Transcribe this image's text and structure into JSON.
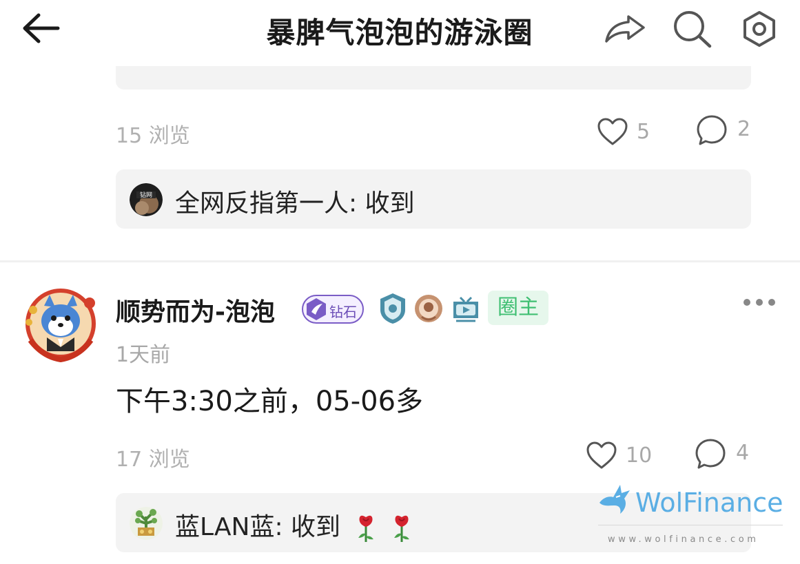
{
  "header": {
    "title": "暴脾气泡泡的游泳圈",
    "icons": [
      "back-arrow-icon",
      "share-icon",
      "search-icon",
      "settings-icon"
    ]
  },
  "previous_post": {
    "views": "15 浏览",
    "likes": "5",
    "comments": "2",
    "top_comment": {
      "author": "全网反指第一人",
      "text": "全网反指第一人: 收到",
      "avatar_text": "钻网"
    }
  },
  "post": {
    "author": "顺势而为-泡泡",
    "member_level": "钻石",
    "owner_badge": "圈主",
    "time": "1天前",
    "content": "下午3:30之前，05-06多",
    "views": "17 浏览",
    "likes": "10",
    "comments": "4",
    "top_comment": {
      "text": "蓝LAN蓝: 收到",
      "emojis": [
        "rose-icon",
        "rose-icon"
      ]
    }
  },
  "watermark": {
    "brand": "WolFinance",
    "url": "www.wolfinance.com"
  },
  "colors": {
    "owner_badge_text": "#3fbf72",
    "owner_badge_bg": "#e6f7ec",
    "diamond_badge": "#7a5cc6",
    "muted_text": "#a8a8a8",
    "card_bg": "#f3f3f3",
    "watermark": "#5aaee4"
  }
}
